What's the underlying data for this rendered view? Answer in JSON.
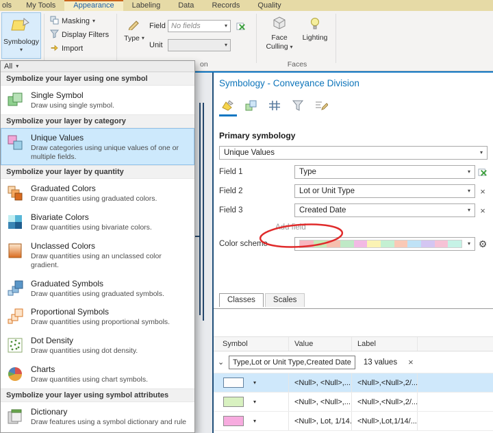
{
  "icons": {
    "dropdown": "▾",
    "close": "×",
    "expand": "⌄",
    "gear": "⚙"
  },
  "colors": {
    "accent_blue": "#0e76c2",
    "pane_border": "#1f4e79",
    "selection_blue": "#cfe8fb",
    "annotation_red": "#e02b2b",
    "row_swatches": [
      "#fdfdfd",
      "#d8f1c0",
      "#f7abdf"
    ],
    "swatch_borders": [
      "#5f7f9e",
      "#8c8c8c",
      "#8c8c8c"
    ],
    "color_scheme": [
      "#f8b6c0",
      "#c8eab6",
      "#f6bfae",
      "#bfe9c6",
      "#f2b9e4",
      "#fbf3b4",
      "#c4f0d2",
      "#f9c9b6",
      "#bfe2f6",
      "#d4c6f2",
      "#f6c2d6",
      "#c6f2e6"
    ]
  },
  "ribbon": {
    "tabs": [
      {
        "label": "ols"
      },
      {
        "label": "My Tools"
      },
      {
        "label": "Appearance"
      },
      {
        "label": "Labeling"
      },
      {
        "label": "Data"
      },
      {
        "label": "Records"
      },
      {
        "label": "Quality"
      }
    ],
    "symbology_button": "Symbology",
    "masking": "Masking",
    "display_filters": "Display Filters",
    "import": "Import",
    "type_label": "Type",
    "field_label": "Field",
    "field_value": "No fields",
    "unit_label": "Unit",
    "face_culling_line1": "Face",
    "face_culling_line2": "Culling",
    "lighting": "Lighting",
    "group_faces": "Faces",
    "group_partial": "on"
  },
  "gallery": {
    "filter": "All",
    "sections": [
      {
        "header": "Symbolize your layer using one symbol",
        "items": [
          {
            "title": "Single Symbol",
            "desc": "Draw using single symbol."
          }
        ]
      },
      {
        "header": "Symbolize your layer by category",
        "items": [
          {
            "title": "Unique Values",
            "desc": "Draw categories using unique values of one or multiple fields."
          }
        ]
      },
      {
        "header": "Symbolize your layer by quantity",
        "items": [
          {
            "title": "Graduated Colors",
            "desc": "Draw quantities using graduated colors."
          },
          {
            "title": "Bivariate Colors",
            "desc": "Draw quantities using bivariate colors."
          },
          {
            "title": "Unclassed Colors",
            "desc": "Draw quantities using an unclassed color gradient."
          },
          {
            "title": "Graduated Symbols",
            "desc": "Draw quantities using graduated symbols."
          },
          {
            "title": "Proportional Symbols",
            "desc": "Draw quantities using proportional symbols."
          },
          {
            "title": "Dot Density",
            "desc": "Draw quantities using dot density."
          },
          {
            "title": "Charts",
            "desc": "Draw quantities using chart symbols."
          }
        ]
      },
      {
        "header": "Symbolize your layer using symbol attributes",
        "items": [
          {
            "title": "Dictionary",
            "desc": "Draw features using a symbol dictionary and rule"
          }
        ]
      }
    ]
  },
  "panel": {
    "title": "Symbology - Conveyance Division",
    "primary_heading": "Primary symbology",
    "primary_value": "Unique Values",
    "field1_label": "Field 1",
    "field1_value": "Type",
    "field2_label": "Field 2",
    "field2_value": "Lot or Unit Type",
    "field3_label": "Field 3",
    "field3_value": "Created Date",
    "add_field": "Add field",
    "color_scheme_label": "Color scheme",
    "tab_classes": "Classes",
    "tab_scales": "Scales",
    "table": {
      "col_symbol": "Symbol",
      "col_value": "Value",
      "col_label": "Label",
      "group_fields": "Type,Lot or Unit Type,Created Date",
      "group_count": "13 values",
      "rows": [
        {
          "value": "<Null>, <Null>,...",
          "label": "<Null>,<Null>,2/..."
        },
        {
          "value": "<Null>, <Null>,...",
          "label": "<Null>,<Null>,2/..."
        },
        {
          "value": "<Null>, Lot, 1/14...",
          "label": "<Null>,Lot,1/14/..."
        }
      ]
    }
  }
}
